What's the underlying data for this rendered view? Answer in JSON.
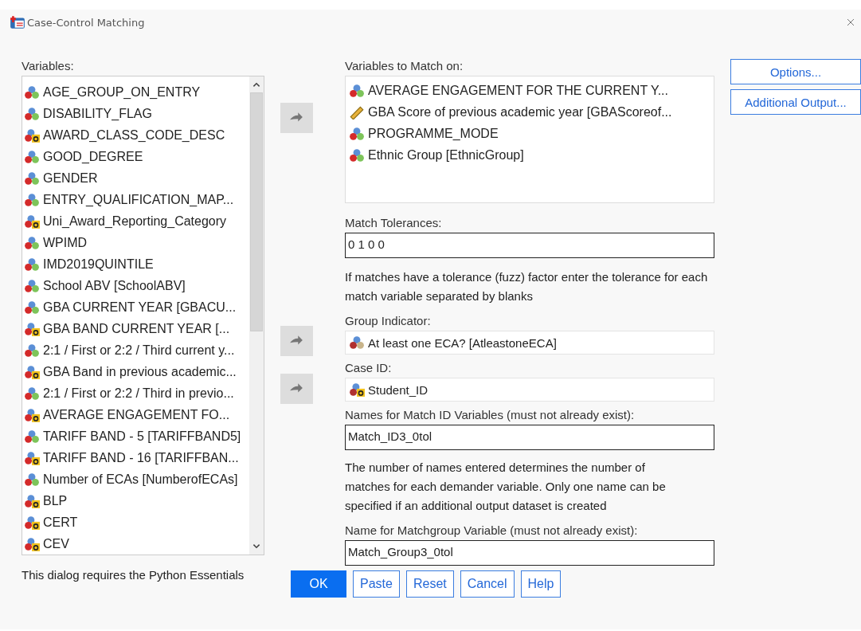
{
  "window": {
    "title": "Case-Control Matching"
  },
  "variables": {
    "label": "Variables:",
    "items": [
      {
        "name": "AGE_GROUP_ON_ENTRY",
        "kind": "nominal"
      },
      {
        "name": "DISABILITY_FLAG",
        "kind": "nominal"
      },
      {
        "name": "AWARD_CLASS_CODE_DESC",
        "kind": "nominal_string"
      },
      {
        "name": "GOOD_DEGREE",
        "kind": "nominal"
      },
      {
        "name": "GENDER",
        "kind": "nominal"
      },
      {
        "name": "ENTRY_QUALIFICATION_MAP...",
        "kind": "nominal"
      },
      {
        "name": "Uni_Award_Reporting_Category",
        "kind": "nominal_string"
      },
      {
        "name": "WPIMD",
        "kind": "nominal"
      },
      {
        "name": "IMD2019QUINTILE",
        "kind": "nominal"
      },
      {
        "name": "School ABV [SchoolABV]",
        "kind": "nominal"
      },
      {
        "name": "GBA CURRENT YEAR [GBACU...",
        "kind": "nominal"
      },
      {
        "name": "GBA BAND CURRENT YEAR [...",
        "kind": "nominal_string"
      },
      {
        "name": "2:1 / First or 2:2 / Third current y...",
        "kind": "nominal"
      },
      {
        "name": "GBA Band in previous academic...",
        "kind": "nominal_string"
      },
      {
        "name": "2:1 / First or 2:2 / Third in previo...",
        "kind": "nominal"
      },
      {
        "name": "AVERAGE ENGAGEMENT FO...",
        "kind": "nominal_string"
      },
      {
        "name": "TARIFF BAND - 5 [TARIFFBAND5]",
        "kind": "nominal"
      },
      {
        "name": "TARIFF BAND - 16 [TARIFFBAN...",
        "kind": "nominal_string"
      },
      {
        "name": "Number of ECAs [NumberofECAs]",
        "kind": "nominal"
      },
      {
        "name": "BLP",
        "kind": "nominal_string"
      },
      {
        "name": "CERT",
        "kind": "nominal_string"
      },
      {
        "name": "CEV",
        "kind": "nominal_string"
      }
    ]
  },
  "note": "This dialog requires the Python Essentials",
  "match_on": {
    "label": "Variables to Match on:",
    "items": [
      {
        "name": "AVERAGE ENGAGEMENT FOR THE CURRENT Y...",
        "kind": "nominal"
      },
      {
        "name": "GBA Score of previous academic year [GBAScoreof...",
        "kind": "scale"
      },
      {
        "name": "PROGRAMME_MODE",
        "kind": "nominal"
      },
      {
        "name": "Ethnic Group [EthnicGroup]",
        "kind": "nominal"
      }
    ]
  },
  "match_tolerances": {
    "label": "Match Tolerances:",
    "value": "0 1 0 0",
    "help": "If matches have a tolerance (fuzz) factor enter the tolerance for each match variable separated by blanks"
  },
  "group_indicator": {
    "label": "Group Indicator:",
    "item": {
      "name": "At least one ECA? [AtleastoneECA]",
      "kind": "nominal"
    }
  },
  "case_id": {
    "label": "Case ID:",
    "item": {
      "name": "Student_ID",
      "kind": "nominal_string"
    }
  },
  "match_id_names": {
    "label": "Names for Match ID Variables (must not already exist):",
    "value": "Match_ID3_0tol",
    "help": "The number of names entered determines the number of matches for each demander variable.  Only one name can be specified if an additional output dataset is created"
  },
  "matchgroup_name": {
    "label": "Name for Matchgroup Variable (must not already exist):",
    "value": "Match_Group3_0tol"
  },
  "side_buttons": [
    "Options...",
    "Additional Output..."
  ],
  "buttons": [
    {
      "label": "OK",
      "default": true
    },
    {
      "label": "Paste",
      "default": false
    },
    {
      "label": "Reset",
      "default": false
    },
    {
      "label": "Cancel",
      "default": false
    },
    {
      "label": "Help",
      "default": false
    }
  ]
}
